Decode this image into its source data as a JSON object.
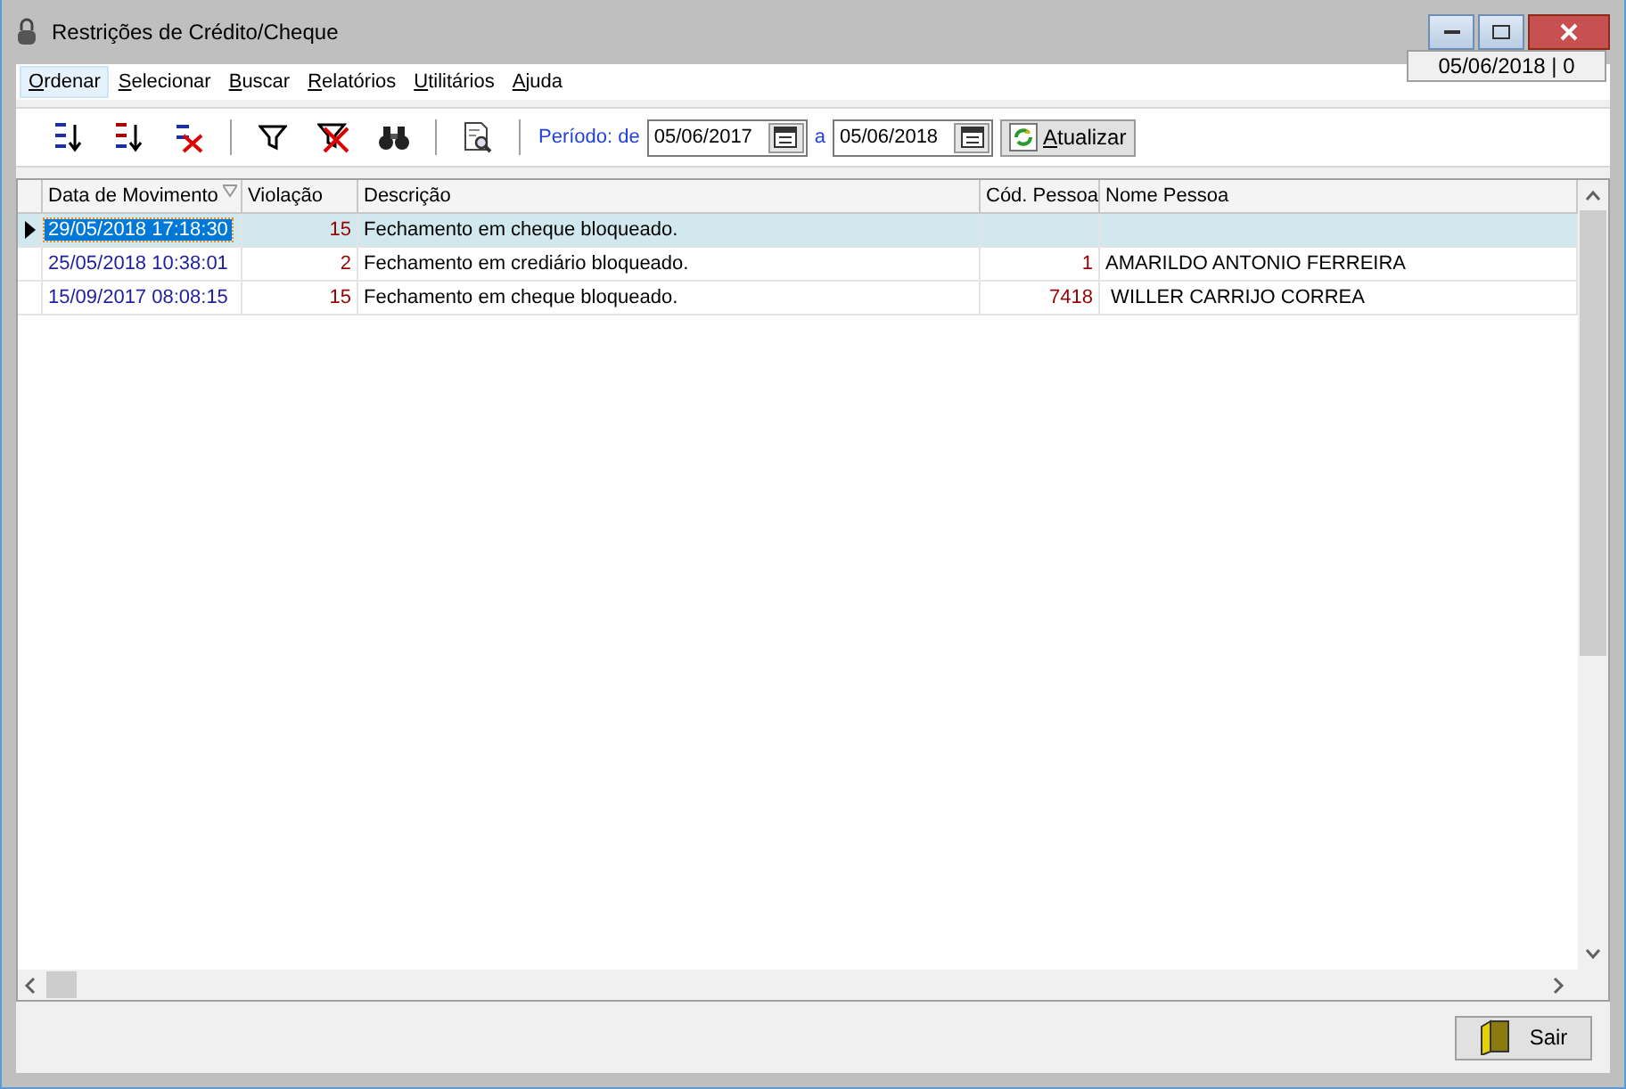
{
  "window": {
    "title": "Restrições de Crédito/Cheque",
    "status": "05/06/2018 | 0"
  },
  "menu": [
    {
      "label": "Ordenar",
      "selected": true
    },
    {
      "label": "Selecionar",
      "selected": false
    },
    {
      "label": "Buscar",
      "selected": false
    },
    {
      "label": "Relatórios",
      "selected": false
    },
    {
      "label": "Utilitários",
      "selected": false
    },
    {
      "label": "Ajuda",
      "selected": false
    }
  ],
  "toolbar": {
    "tools": [
      {
        "kind": "sort_asc"
      },
      {
        "kind": "sort_desc"
      },
      {
        "kind": "sort_clear"
      },
      {
        "kind": "separator"
      },
      {
        "kind": "filter"
      },
      {
        "kind": "filter_clear"
      },
      {
        "kind": "find"
      },
      {
        "kind": "separator"
      },
      {
        "kind": "preview"
      },
      {
        "kind": "separator"
      }
    ],
    "period_label": "Período: de",
    "from": "05/06/2017",
    "to_label": "a",
    "to": "05/06/2018",
    "refresh": "Atualizar"
  },
  "table": {
    "columns": [
      {
        "label": "Data de Movimento",
        "sorted": true
      },
      {
        "label": "Violação",
        "sorted": false
      },
      {
        "label": "Descrição",
        "sorted": false
      },
      {
        "label": "Cód. Pessoa",
        "sorted": false
      },
      {
        "label": "Nome Pessoa",
        "sorted": false
      }
    ],
    "rows": [
      {
        "selected": true,
        "date": "29/05/2018 17:18:30",
        "violation": "15",
        "description": "Fechamento em cheque bloqueado."
      },
      {
        "selected": false,
        "date": "25/05/2018 10:38:01",
        "violation": "2",
        "description": "Fechamento em crediário bloqueado.",
        "person_code": "1",
        "person_name": "AMARILDO ANTONIO FERREIRA"
      },
      {
        "selected": false,
        "date": "15/09/2017 08:08:15",
        "violation": "15",
        "description": "Fechamento em cheque bloqueado.",
        "person_code": "7418",
        "person_name": " WILLER CARRIJO CORREA"
      }
    ]
  },
  "footer": {
    "exit": "Sair"
  }
}
